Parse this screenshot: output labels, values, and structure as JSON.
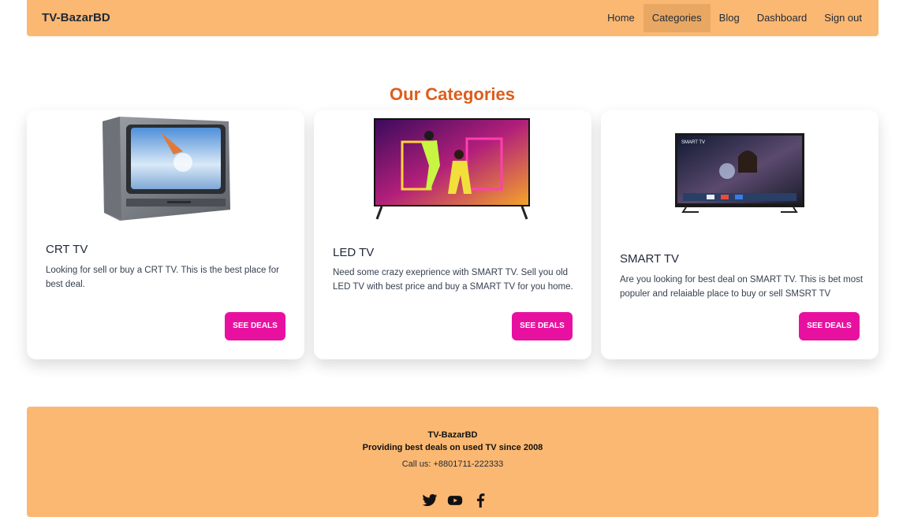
{
  "nav": {
    "brand": "TV-BazarBD",
    "items": [
      {
        "label": "Home",
        "active": false
      },
      {
        "label": "Categories",
        "active": true
      },
      {
        "label": "Blog",
        "active": false
      },
      {
        "label": "Dashboard",
        "active": false
      },
      {
        "label": "Sign out",
        "active": false
      }
    ]
  },
  "section": {
    "title": "Our Categories"
  },
  "categories": [
    {
      "title": "CRT TV",
      "description": "Looking for sell or buy a CRT TV. This is the best place for best deal.",
      "button": "SEE DEALS",
      "image": "crt-tv-image"
    },
    {
      "title": "LED TV",
      "description": "Need some crazy exeprience with SMART TV. Sell you old LED TV with best price and buy a SMART TV for you home.",
      "button": "SEE DEALS",
      "image": "led-tv-image"
    },
    {
      "title": "SMART TV",
      "description": "Are you looking for best deal on SMART TV. This is bet most populer and relaiable place to buy or sell SMSRT TV",
      "button": "SEE DEALS",
      "image": "smart-tv-image"
    }
  ],
  "smart_tv_screen_label": "SMART TV",
  "footer": {
    "brand": "TV-BazarBD",
    "tagline": "Providing best deals on used TV since 2008",
    "phone": "Call us: +8801711-222333",
    "socials": [
      "twitter-icon",
      "youtube-icon",
      "facebook-icon"
    ]
  },
  "colors": {
    "nav_bg": "#fbb872",
    "active_nav": "#e8a864",
    "title": "#dc5e1c",
    "button": "#e8119f"
  }
}
